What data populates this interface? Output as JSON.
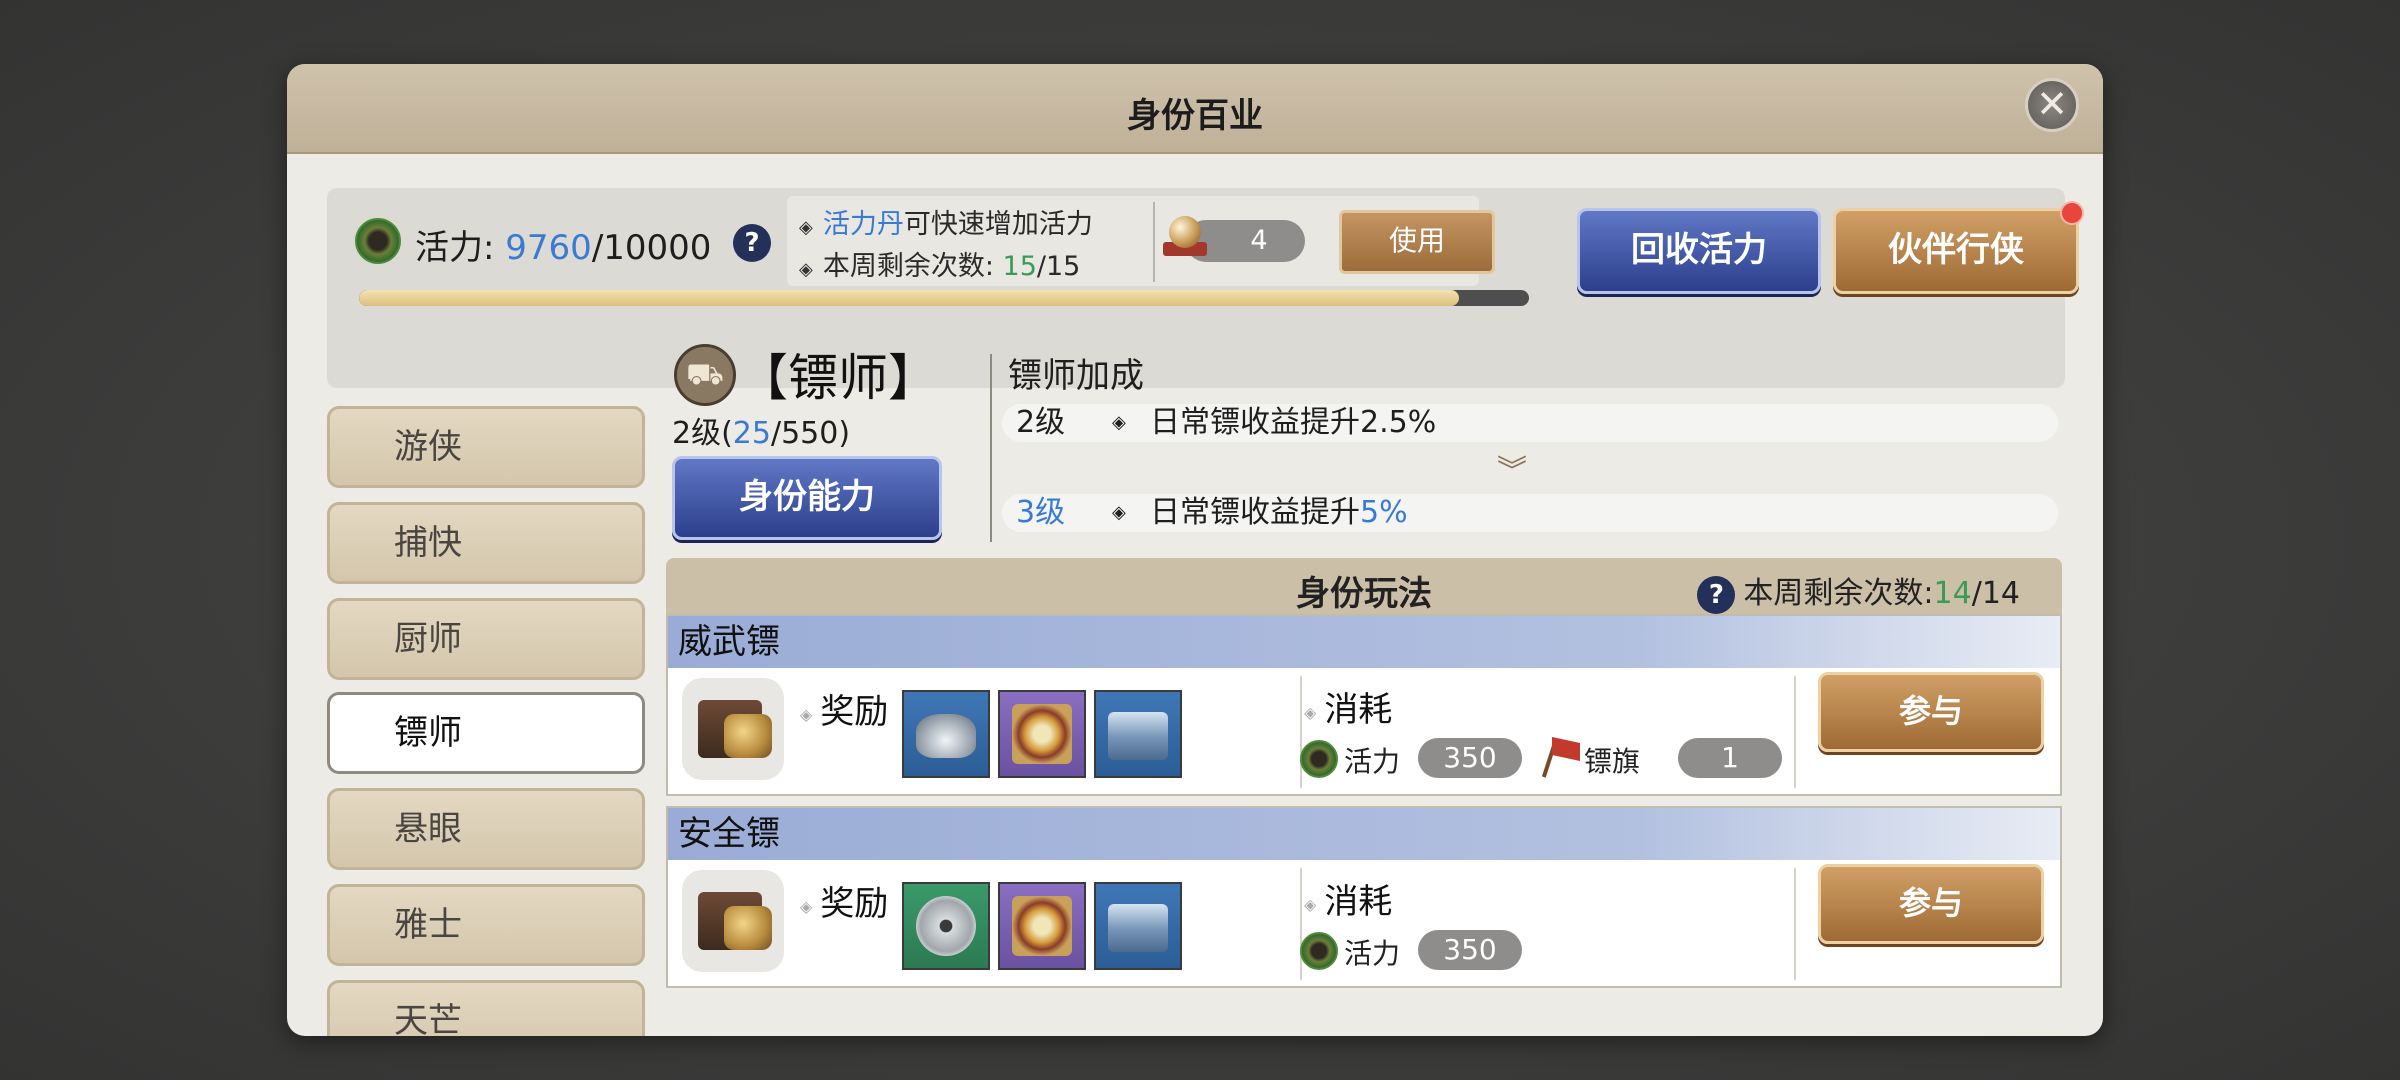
{
  "window": {
    "title": "身份百业"
  },
  "stamina": {
    "label": "活力:",
    "current": "9760",
    "max": "/10000",
    "fill_fraction": 0.94
  },
  "tips": {
    "line1_highlight": "活力丹",
    "line1_rest": "可快速增加活力",
    "line2_label": "本周剩余次数: ",
    "line2_current": "15",
    "line2_max": "/15"
  },
  "item": {
    "count": "4",
    "use_label": "使用"
  },
  "buttons": {
    "reclaim": "回收活力",
    "partner": "伙伴行侠",
    "ability": "身份能力"
  },
  "sidebar": {
    "items": [
      {
        "label": "游侠"
      },
      {
        "label": "捕快"
      },
      {
        "label": "厨师"
      },
      {
        "label": "镖师",
        "active": true
      },
      {
        "label": "悬眼"
      },
      {
        "label": "雅士"
      },
      {
        "label": "天芒"
      }
    ]
  },
  "profession": {
    "name": "【镖师】",
    "level_prefix": "2级(",
    "exp_current": "25",
    "exp_max": "/550)"
  },
  "bonus": {
    "title": "镖师加成",
    "current": {
      "level": "2级",
      "text": "日常镖收益提升2.5%"
    },
    "next": {
      "level": "3级",
      "text_prefix": "日常镖收益提升",
      "text_value": "5%"
    }
  },
  "gameplay": {
    "title": "身份玩法",
    "remain_label": "本周剩余次数:",
    "remain_current": "14",
    "remain_max": "/14",
    "routes": [
      {
        "name": "威武镖",
        "reward_label": "奖励",
        "cost_label": "消耗",
        "cost1_name": "活力",
        "cost1_value": "350",
        "cost2_name": "镖旗",
        "cost2_value": "1",
        "join_label": "参与"
      },
      {
        "name": "安全镖",
        "reward_label": "奖励",
        "cost_label": "消耗",
        "cost1_name": "活力",
        "cost1_value": "350",
        "join_label": "参与"
      }
    ]
  },
  "colors": {
    "accent_blue": "#3a7ad4",
    "accent_green": "#3a9a58",
    "notification_red": "#e8453c"
  },
  "icons": {
    "close": "close-icon",
    "stamina": "jade-stamina-icon",
    "help": "question-icon",
    "pearl": "pearl-item-icon",
    "profession": "cart-icon",
    "expand": "double-chevron-down-icon",
    "rewards": [
      "silver-ingot-icon",
      "compass-icon",
      "treasure-chest-icon",
      "copper-coin-icon"
    ]
  }
}
